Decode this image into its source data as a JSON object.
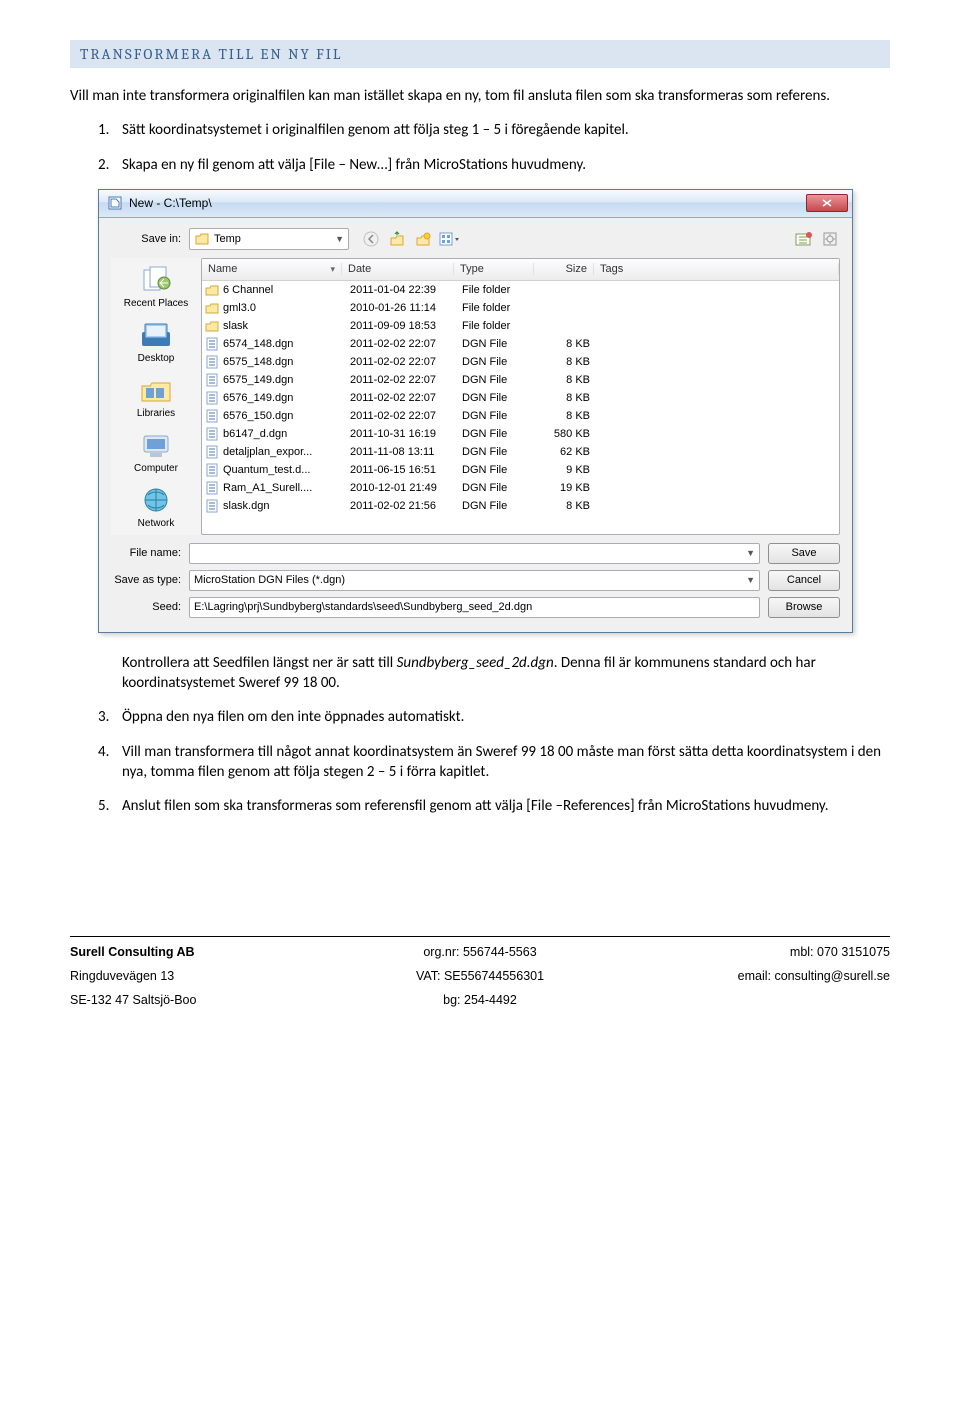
{
  "heading": "TRANSFORMERA TILL EN NY FIL",
  "intro": "Vill man inte transformera originalfilen kan man istället skapa en ny, tom fil ansluta filen som ska transformeras som referens.",
  "steps_top": [
    {
      "n": "1.",
      "t": "Sätt koordinatsystemet i originalfilen genom att följa steg 1 – 5 i föregående kapitel."
    },
    {
      "n": "2.",
      "t": "Skapa en ny fil genom att välja [File – New…] från MicroStations huvudmeny."
    }
  ],
  "dialog": {
    "title": "New - C:\\Temp\\",
    "savein_label": "Save in:",
    "current_folder": "Temp",
    "columns": {
      "name": "Name",
      "date": "Date",
      "type": "Type",
      "size": "Size",
      "tags": "Tags"
    },
    "places": [
      {
        "label": "Recent Places"
      },
      {
        "label": "Desktop"
      },
      {
        "label": "Libraries"
      },
      {
        "label": "Computer"
      },
      {
        "label": "Network"
      }
    ],
    "files": [
      {
        "icon": "folder",
        "name": "6 Channel",
        "date": "2011-01-04 22:39",
        "type": "File folder",
        "size": ""
      },
      {
        "icon": "folder",
        "name": "gml3.0",
        "date": "2010-01-26 11:14",
        "type": "File folder",
        "size": ""
      },
      {
        "icon": "folder",
        "name": "slask",
        "date": "2011-09-09 18:53",
        "type": "File folder",
        "size": ""
      },
      {
        "icon": "dgn",
        "name": "6574_148.dgn",
        "date": "2011-02-02 22:07",
        "type": "DGN File",
        "size": "8 KB"
      },
      {
        "icon": "dgn",
        "name": "6575_148.dgn",
        "date": "2011-02-02 22:07",
        "type": "DGN File",
        "size": "8 KB"
      },
      {
        "icon": "dgn",
        "name": "6575_149.dgn",
        "date": "2011-02-02 22:07",
        "type": "DGN File",
        "size": "8 KB"
      },
      {
        "icon": "dgn",
        "name": "6576_149.dgn",
        "date": "2011-02-02 22:07",
        "type": "DGN File",
        "size": "8 KB"
      },
      {
        "icon": "dgn",
        "name": "6576_150.dgn",
        "date": "2011-02-02 22:07",
        "type": "DGN File",
        "size": "8 KB"
      },
      {
        "icon": "dgn",
        "name": "b6147_d.dgn",
        "date": "2011-10-31 16:19",
        "type": "DGN File",
        "size": "580 KB"
      },
      {
        "icon": "dgn",
        "name": "detaljplan_expor...",
        "date": "2011-11-08 13:11",
        "type": "DGN File",
        "size": "62 KB"
      },
      {
        "icon": "dgn",
        "name": "Quantum_test.d...",
        "date": "2011-06-15 16:51",
        "type": "DGN File",
        "size": "9 KB"
      },
      {
        "icon": "dgn",
        "name": "Ram_A1_Surell....",
        "date": "2010-12-01 21:49",
        "type": "DGN File",
        "size": "19 KB"
      },
      {
        "icon": "dgn",
        "name": "slask.dgn",
        "date": "2011-02-02 21:56",
        "type": "DGN File",
        "size": "8 KB"
      }
    ],
    "filename_label": "File name:",
    "filename_value": "",
    "saveas_label": "Save as type:",
    "saveas_value": "MicroStation DGN Files (*.dgn)",
    "seed_label": "Seed:",
    "seed_value": "E:\\Lagring\\prj\\Sundbyberg\\standards\\seed\\Sundbyberg_seed_2d.dgn",
    "btn_save": "Save",
    "btn_cancel": "Cancel",
    "btn_browse": "Browse"
  },
  "after_dlg_prefix": "Kontrollera att Seedfilen längst ner är satt till ",
  "after_dlg_em": "Sundbyberg_seed_2d.dgn",
  "after_dlg_suffix": ". Denna fil är kommunens standard och har koordinatsystemet Sweref 99 18 00.",
  "steps_bottom": [
    {
      "n": "3.",
      "t": "Öppna den nya filen om den inte öppnades automatiskt."
    },
    {
      "n": "4.",
      "t": "Vill man transformera till något annat koordinatsystem än Sweref 99 18 00 måste man först sätta detta koordinatsystem i den nya, tomma filen genom att följa stegen 2 – 5 i förra kapitlet."
    },
    {
      "n": "5.",
      "t": "Anslut filen som ska transformeras som referensfil genom att välja [File –References] från MicroStations huvudmeny."
    }
  ],
  "footer": {
    "company": "Surell Consulting AB",
    "orgnr": "org.nr: 556744-5563",
    "mbl": "mbl: 070 3151075",
    "addr1": "Ringduvevägen 13",
    "vat": "VAT: SE556744556301",
    "email": "email: consulting@surell.se",
    "addr2": "SE-132 47 Saltsjö-Boo",
    "bg": "bg: 254-4492"
  }
}
